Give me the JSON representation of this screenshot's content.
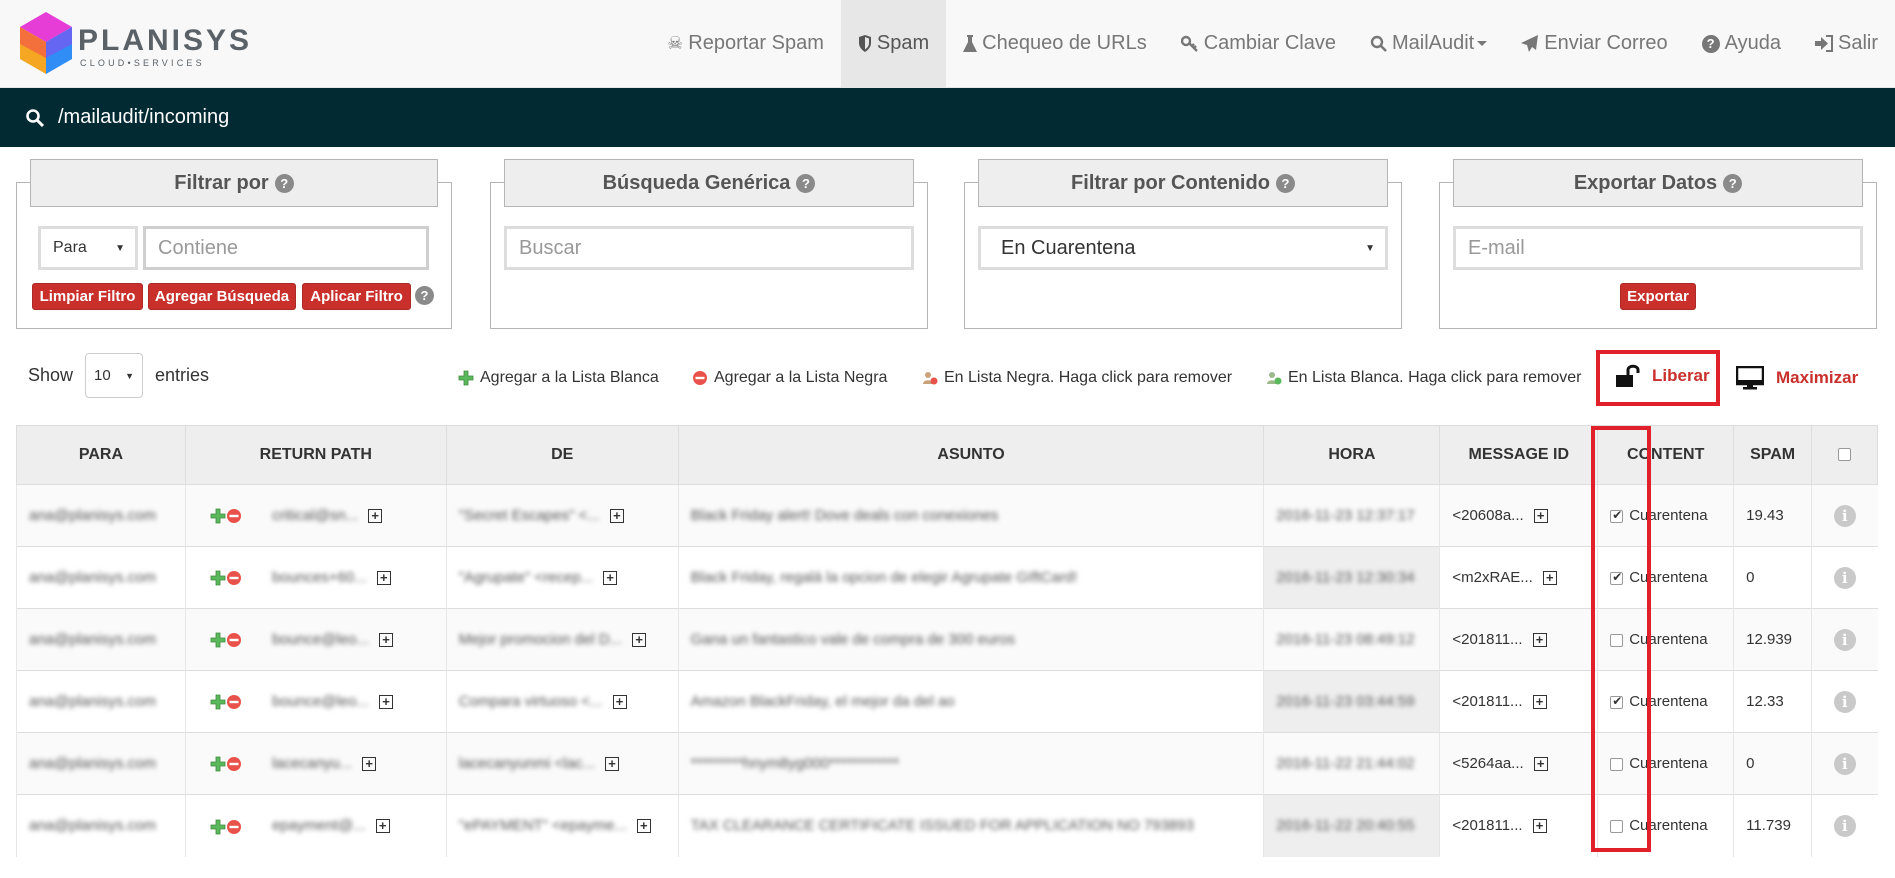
{
  "brand": {
    "name": "PLANISYS",
    "sub": "CLOUD•SERVICES"
  },
  "nav": [
    {
      "icon": "skull-icon",
      "label": "Reportar Spam"
    },
    {
      "icon": "shield-icon",
      "label": "Spam",
      "active": true
    },
    {
      "icon": "flask-icon",
      "label": "Chequeo de URLs"
    },
    {
      "icon": "key-icon",
      "label": "Cambiar Clave"
    },
    {
      "icon": "search-icon",
      "label": "MailAudit",
      "dropdown": true
    },
    {
      "icon": "send-icon",
      "label": "Enviar Correo"
    },
    {
      "icon": "question-icon",
      "label": "Ayuda"
    },
    {
      "icon": "logout-icon",
      "label": "Salir"
    }
  ],
  "path": "/mailaudit/incoming",
  "panels": {
    "filtrar": {
      "title": "Filtrar por",
      "select_value": "Para",
      "placeholder": "Contiene",
      "buttons": [
        "Limpiar Filtro",
        "Agregar Búsqueda",
        "Aplicar Filtro"
      ]
    },
    "busqueda": {
      "title": "Búsqueda Genérica",
      "placeholder": "Buscar"
    },
    "contenido": {
      "title": "Filtrar por Contenido",
      "select_value": "En Cuarentena"
    },
    "exportar": {
      "title": "Exportar Datos",
      "placeholder": "E-mail",
      "button": "Exportar"
    }
  },
  "length": {
    "show": "Show",
    "value": "10",
    "entries": "entries"
  },
  "legend": {
    "whitelist_add": "Agregar a la Lista Blanca",
    "blacklist_add": "Agregar a la Lista Negra",
    "in_blacklist": "En Lista Negra. Haga click para remover",
    "in_whitelist": "En Lista Blanca. Haga click para remover",
    "liberar": "Liberar",
    "maximizar": "Maximizar"
  },
  "table": {
    "headers": [
      "PARA",
      "RETURN PATH",
      "DE",
      "ASUNTO",
      "HORA",
      "MESSAGE ID",
      "CONTENT",
      "SPAM"
    ],
    "rows": [
      {
        "para": "ana@planisys.com",
        "return_path": "critical@sn...",
        "de": "\"Secret Escapes\" <...",
        "asunto": "Black Friday alert! Dove deals con conexiones",
        "hora": "2016-11-23 12:37:17",
        "message_id": "<20608a...",
        "checked": true,
        "content": "Cuarentena",
        "spam": "19.43"
      },
      {
        "para": "ana@planisys.com",
        "return_path": "bounces+60...",
        "de": "\"Agrupate\" <recep...",
        "asunto": "Black Friday, regalá la opcion de elegir Agrupate GIftCard!",
        "hora": "2016-11-23 12:30:34",
        "message_id": "<m2xRAE...",
        "checked": true,
        "content": "Cuarentena",
        "spam": "0"
      },
      {
        "para": "ana@planisys.com",
        "return_path": "bounce@leo...",
        "de": "Mejor promocion del D...",
        "asunto": "Gana un fantastico vale de compra de 300 euros",
        "hora": "2016-11-23 08:49:12",
        "message_id": "<201811...",
        "checked": false,
        "content": "Cuarentena",
        "spam": "12.939"
      },
      {
        "para": "ana@planisys.com",
        "return_path": "bounce@leo...",
        "de": "Compara virtuoso <...",
        "asunto": "Amazon BlackFriday, el mejor da del ao",
        "hora": "2016-11-23 03:44:59",
        "message_id": "<201811...",
        "checked": true,
        "content": "Cuarentena",
        "spam": "12.33"
      },
      {
        "para": "ana@planisys.com",
        "return_path": "lacecanyu...",
        "de": "lacecanyunmi <lac...",
        "asunto": "*********hnym8yg000************",
        "hora": "2016-11-22 21:44:02",
        "message_id": "<5264aa...",
        "checked": false,
        "content": "Cuarentena",
        "spam": "0"
      },
      {
        "para": "ana@planisys.com",
        "return_path": "epayment@...",
        "de": "\"ePAYMENT\" <epayme...",
        "asunto": "TAX CLEARANCE CERTIFICATE ISSUED FOR APPLICATION NO 793893",
        "hora": "2016-11-22 20:40:55",
        "message_id": "<201811...",
        "checked": false,
        "content": "Cuarentena",
        "spam": "11.739"
      }
    ]
  },
  "colors": {
    "accent_red": "#c9302c",
    "pathbar": "#022a33",
    "highlight": "#e0202a"
  }
}
